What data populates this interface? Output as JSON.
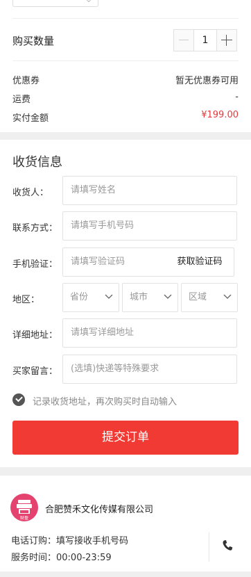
{
  "order": {
    "quantity_label": "购买数量",
    "quantity_value": "1",
    "coupon_label": "优惠券",
    "coupon_value": "暂无优惠券可用",
    "shipping_label": "运费",
    "shipping_value": "-",
    "total_label": "实付金额",
    "total_value": "¥199.00"
  },
  "shipping_form": {
    "title": "收货信息",
    "name_label": "收货人：",
    "name_placeholder": "请填写姓名",
    "contact_label": "联系方式：",
    "contact_placeholder": "请填写手机号码",
    "verify_label": "手机验证：",
    "verify_placeholder": "请填写验证码",
    "get_code_label": "获取验证码",
    "region_label": "地区：",
    "province": "省份",
    "city": "城市",
    "district": "区域",
    "address_label": "详细地址：",
    "address_placeholder": "请填写详细地址",
    "message_label": "买家留言：",
    "message_placeholder": "(选填)快递等特殊要求",
    "remember_text": "记录收货地址，再次购买时自动输入",
    "submit_label": "提交订单"
  },
  "shop": {
    "name": "合肥赞禾文化传媒有限公司",
    "logo_text": "财盈",
    "phone_line": "电话订购：填写接收手机号码",
    "hours_line": "服务时间：00:00-23:59"
  },
  "colors": {
    "accent": "#f23a35",
    "price": "#e4393c",
    "logo_bg": "#e5436f"
  }
}
